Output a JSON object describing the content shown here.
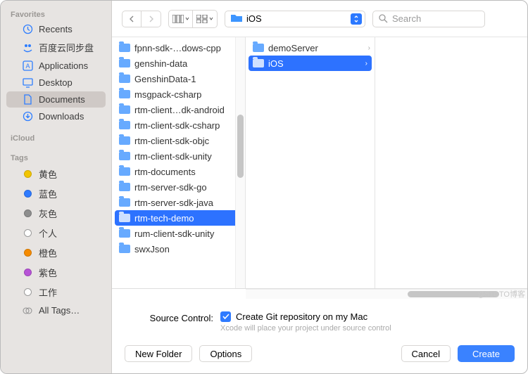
{
  "sidebar": {
    "sections": {
      "favorites": "Favorites",
      "icloud": "iCloud",
      "tags": "Tags"
    },
    "favorites": [
      {
        "icon": "clock",
        "label": "Recents"
      },
      {
        "icon": "baidu",
        "label": "百度云同步盘"
      },
      {
        "icon": "apps",
        "label": "Applications"
      },
      {
        "icon": "desktop",
        "label": "Desktop"
      },
      {
        "icon": "doc",
        "label": "Documents"
      },
      {
        "icon": "download",
        "label": "Downloads"
      }
    ],
    "tags": [
      {
        "color": "#f2c500",
        "label": "黄色"
      },
      {
        "color": "#2f7bff",
        "label": "蓝色"
      },
      {
        "color": "#8e8e8e",
        "label": "灰色"
      },
      {
        "color": "",
        "label": "个人",
        "ring": true
      },
      {
        "color": "#f58b00",
        "label": "橙色"
      },
      {
        "color": "#b753d6",
        "label": "紫色"
      },
      {
        "color": "",
        "label": "工作",
        "ring": true
      },
      {
        "color": "",
        "label": "All Tags…",
        "all": true
      }
    ]
  },
  "toolbar": {
    "path_label": "iOS",
    "search_placeholder": "Search"
  },
  "col1": [
    "fpnn-sdk-…dows-cpp",
    "genshin-data",
    "GenshinData-1",
    "msgpack-csharp",
    "rtm-client…dk-android",
    "rtm-client-sdk-csharp",
    "rtm-client-sdk-objc",
    "rtm-client-sdk-unity",
    "rtm-documents",
    "rtm-server-sdk-go",
    "rtm-server-sdk-java",
    "rtm-tech-demo",
    "rum-client-sdk-unity",
    "swxJson"
  ],
  "col1_selected": 11,
  "col2": [
    {
      "label": "demoServer"
    },
    {
      "label": "iOS"
    }
  ],
  "col2_selected": 1,
  "source_control": {
    "label": "Source Control:",
    "checkbox": "Create Git repository on my Mac",
    "hint": "Xcode will place your project under source control"
  },
  "buttons": {
    "new_folder": "New Folder",
    "options": "Options",
    "cancel": "Cancel",
    "create": "Create"
  },
  "watermark": "@51CTO博客"
}
